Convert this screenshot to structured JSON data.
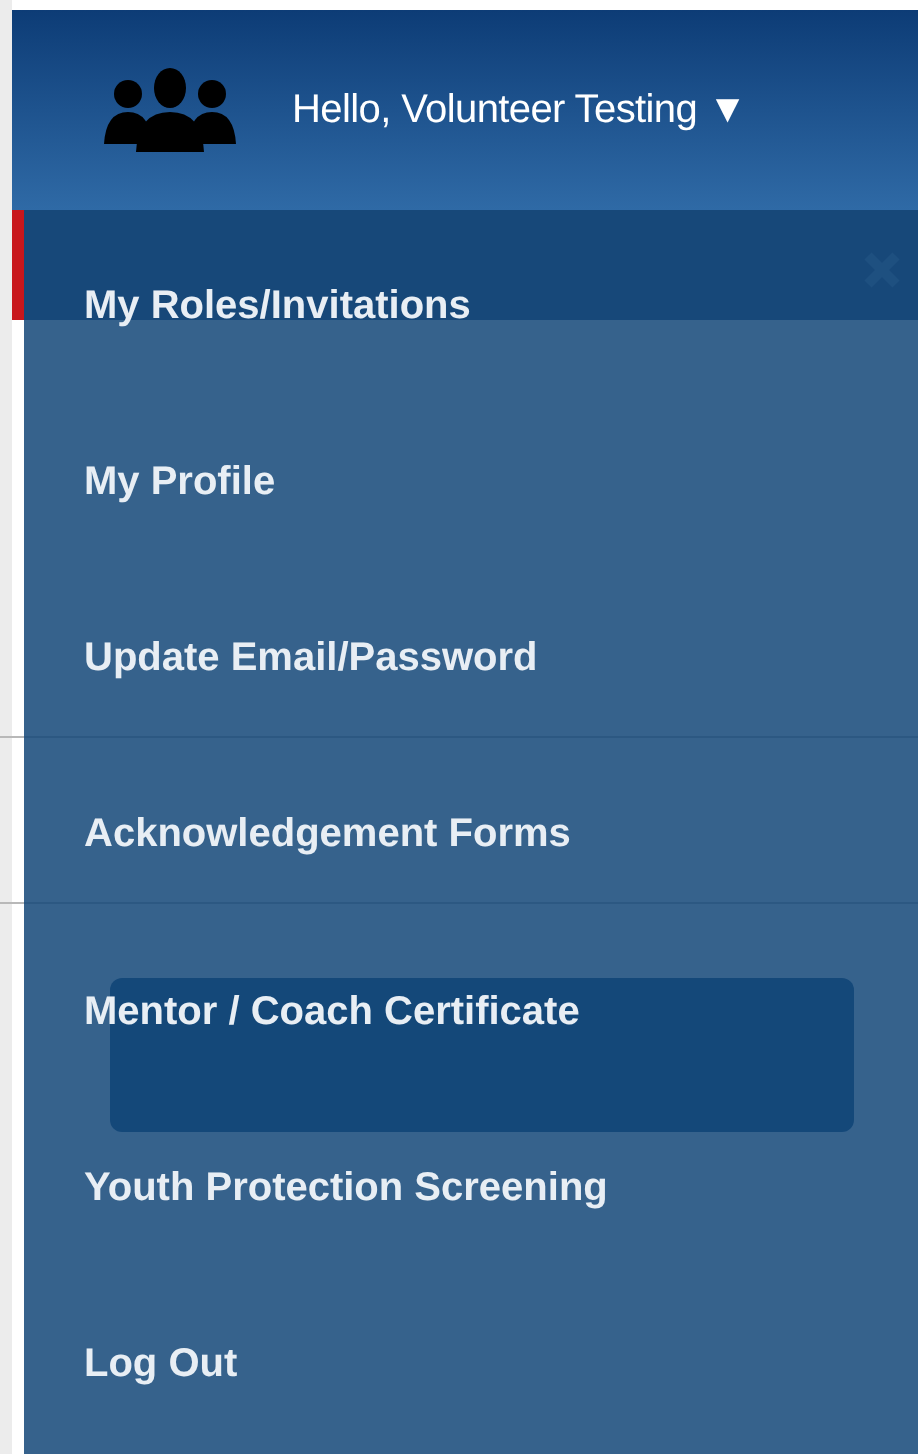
{
  "header": {
    "greeting": "Hello, Volunteer Testing",
    "caret": "▼"
  },
  "menu": {
    "items": [
      {
        "label": "My Roles/Invitations"
      },
      {
        "label": "My Profile"
      },
      {
        "label": "Update Email/Password"
      },
      {
        "label": "Acknowledgement Forms"
      },
      {
        "label": "Mentor / Coach Certificate"
      },
      {
        "label": "Youth Protection Screening"
      },
      {
        "label": "Log Out"
      }
    ]
  }
}
